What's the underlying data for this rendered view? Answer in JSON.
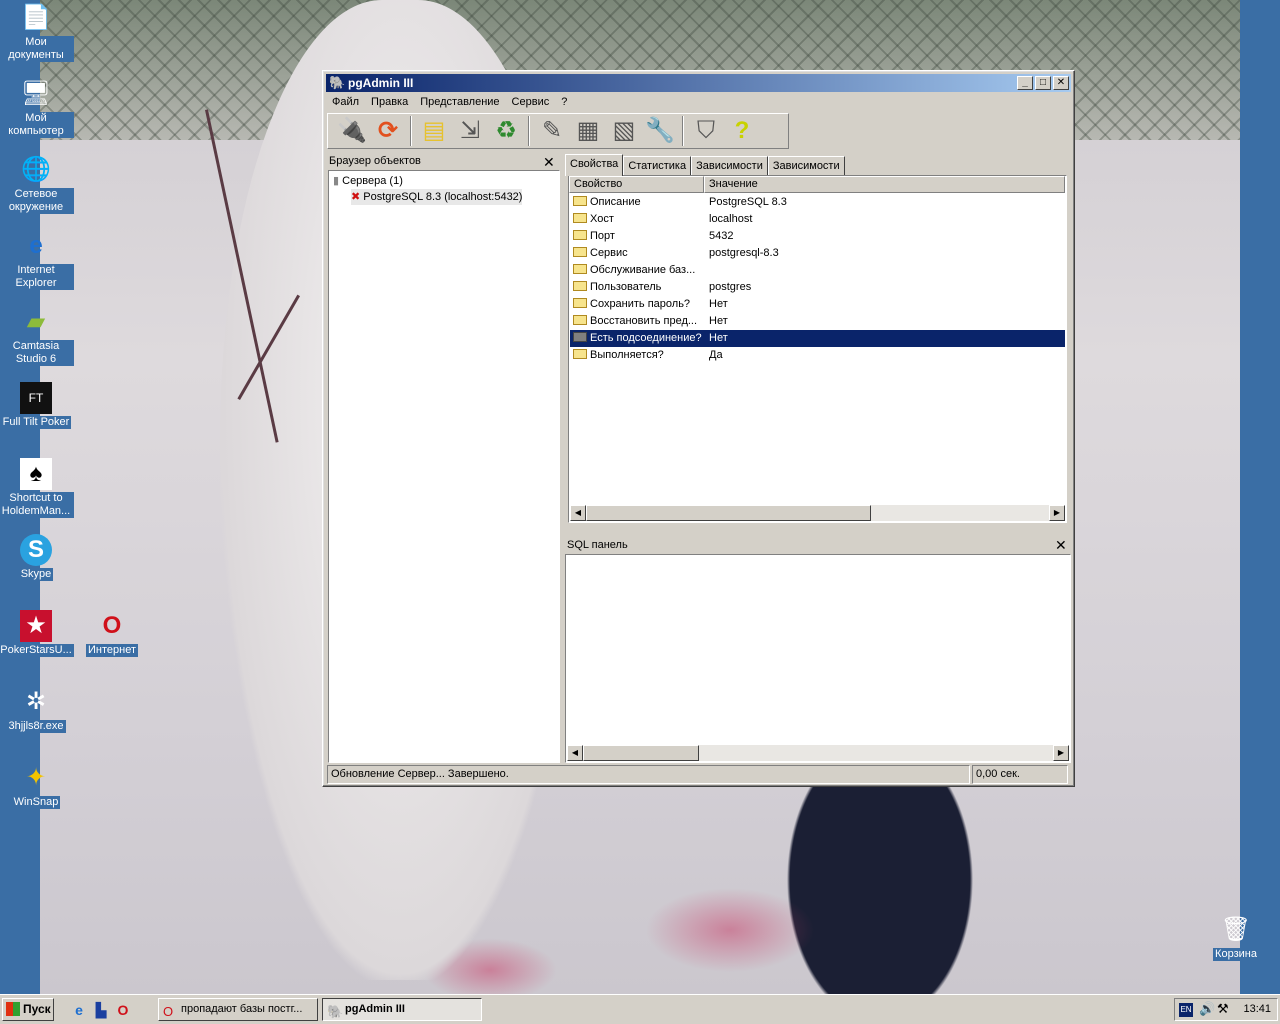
{
  "desktop": {
    "icons": [
      {
        "label": "Мои документы",
        "icon": "documents-icon"
      },
      {
        "label": "Мой компьютер",
        "icon": "computer-icon"
      },
      {
        "label": "Сетевое окружение",
        "icon": "network-icon"
      },
      {
        "label": "Internet Explorer",
        "icon": "ie-icon"
      },
      {
        "label": "Camtasia Studio 6",
        "icon": "camtasia-icon"
      },
      {
        "label": "Full Tilt Poker",
        "icon": "poker-icon"
      },
      {
        "label": "Shortcut to HoldemMan...",
        "icon": "card-icon"
      },
      {
        "label": "Skype",
        "icon": "skype-icon"
      },
      {
        "label": "PokerStarsU...",
        "icon": "pokerstars-icon"
      },
      {
        "label": "Интернет",
        "icon": "opera-icon"
      },
      {
        "label": "3hjjls8r.exe",
        "icon": "exe-icon"
      },
      {
        "label": "WinSnap",
        "icon": "winsnap-icon"
      },
      {
        "label": "Корзина",
        "icon": "recycle-bin-icon"
      }
    ]
  },
  "window": {
    "title": "pgAdmin III",
    "menu": [
      "Файл",
      "Правка",
      "Представление",
      "Сервис",
      "?"
    ],
    "toolbar": [
      "connect-icon",
      "refresh-icon",
      "folder-icon",
      "tree-icon",
      "delete-icon",
      "edit-icon",
      "grid-icon",
      "grid-edit-icon",
      "wrench-icon",
      "filter-icon",
      "help-icon"
    ],
    "browser": {
      "title": "Браузер объектов",
      "close": "✕",
      "root": "Сервера (1)",
      "server": "PostgreSQL 8.3 (localhost:5432)"
    },
    "tabs": [
      "Свойства",
      "Статистика",
      "Зависимости",
      "Зависимости"
    ],
    "props": {
      "col_key": "Свойство",
      "col_val": "Значение",
      "rows": [
        {
          "k": "Описание",
          "v": "PostgreSQL 8.3"
        },
        {
          "k": "Хост",
          "v": "localhost"
        },
        {
          "k": "Порт",
          "v": "5432"
        },
        {
          "k": "Сервис",
          "v": "postgresql-8.3"
        },
        {
          "k": "Обслуживание баз...",
          "v": ""
        },
        {
          "k": "Пользователь",
          "v": "postgres"
        },
        {
          "k": "Сохранить пароль?",
          "v": "Нет"
        },
        {
          "k": "Восстановить пред...",
          "v": "Нет"
        },
        {
          "k": "Есть подсоединение?",
          "v": "Нет"
        },
        {
          "k": "Выполняется?",
          "v": "Да"
        }
      ]
    },
    "sql": {
      "title": "SQL панель",
      "close": "✕"
    },
    "status": {
      "message": "Обновление Сервер... Завершено.",
      "time": "0,00 сек."
    }
  },
  "taskbar": {
    "start": "Пуск",
    "tasks": [
      "пропадают базы постг...",
      "pgAdmin III"
    ],
    "lang": "EN",
    "clock": "13:41"
  }
}
